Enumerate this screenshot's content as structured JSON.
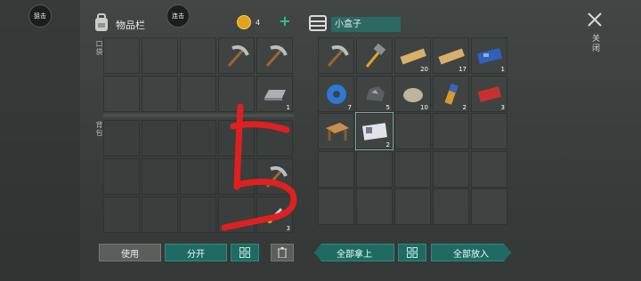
{
  "left_circles": {
    "top": "狙击",
    "second": "连击"
  },
  "inventory": {
    "title": "物品栏",
    "coin_count": "4",
    "hotbar_label": "口袋",
    "backpack_label": "背包",
    "slots": [
      {
        "row": 0,
        "col": 3,
        "item": "pickaxe-icon"
      },
      {
        "row": 0,
        "col": 4,
        "item": "pickaxe-icon"
      },
      {
        "row": 1,
        "col": 4,
        "item": "iron-ingot-icon",
        "qty": "1"
      },
      {
        "row": 3,
        "col": 4,
        "item": "pickaxe-icon"
      },
      {
        "row": 4,
        "col": 4,
        "item": "item-icon",
        "qty": "3"
      }
    ]
  },
  "container": {
    "title": "小盒子",
    "items": [
      {
        "item": "pickaxe-icon"
      },
      {
        "item": "hammer-icon"
      },
      {
        "item": "wood-plank-icon",
        "qty": "20"
      },
      {
        "item": "wood-plank-icon",
        "qty": "17"
      },
      {
        "item": "circuit-board-icon",
        "qty": "1"
      },
      {
        "item": "tape-roll-icon",
        "qty": "7"
      },
      {
        "item": "coal-ore-icon",
        "qty": "5"
      },
      {
        "item": "stone-icon",
        "qty": "10"
      },
      {
        "item": "battery-icon",
        "qty": "2"
      },
      {
        "item": "red-ticket-icon",
        "qty": "3"
      },
      {
        "item": "workbench-icon"
      },
      {
        "item": "id-card-icon",
        "qty": "2"
      }
    ]
  },
  "buttons": {
    "use": "使用",
    "split": "分开",
    "take_all": "全部拿上",
    "put_all": "全部放入"
  },
  "close_label": "关闭",
  "colors": {
    "accent": "#1f6b63",
    "annotation": "#e02020"
  }
}
